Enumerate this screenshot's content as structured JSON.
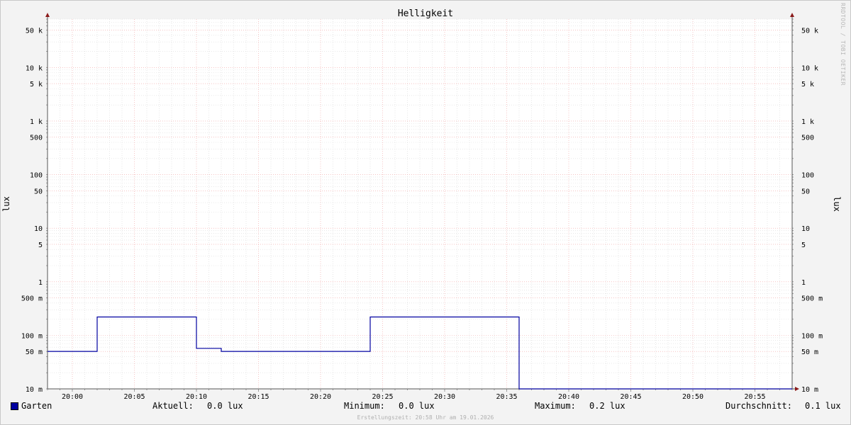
{
  "chart_data": {
    "type": "line",
    "title": "Helligkeit",
    "ylabel": "lux",
    "ylabel_right": "lux",
    "yscale": "log",
    "ylim": [
      0.01,
      80000
    ],
    "y_ticks": [
      {
        "v": 50000,
        "label": "50 k"
      },
      {
        "v": 10000,
        "label": "10 k"
      },
      {
        "v": 5000,
        "label": "5 k"
      },
      {
        "v": 1000,
        "label": "1 k"
      },
      {
        "v": 500,
        "label": "500"
      },
      {
        "v": 100,
        "label": "100"
      },
      {
        "v": 50,
        "label": "50"
      },
      {
        "v": 10,
        "label": "10"
      },
      {
        "v": 5,
        "label": "5"
      },
      {
        "v": 1,
        "label": "1"
      },
      {
        "v": 0.5,
        "label": "500 m"
      },
      {
        "v": 0.1,
        "label": "100 m"
      },
      {
        "v": 0.05,
        "label": "50 m"
      },
      {
        "v": 0.01,
        "label": "10 m"
      }
    ],
    "x_ticks": [
      "20:00",
      "20:05",
      "20:10",
      "20:15",
      "20:20",
      "20:25",
      "20:30",
      "20:35",
      "20:40",
      "20:45",
      "20:50",
      "20:55"
    ],
    "xlim": [
      "19:58",
      "20:58"
    ],
    "grid": true,
    "series": [
      {
        "name": "Garten",
        "color": "#0000a0",
        "step": true,
        "points": [
          [
            "19:58",
            0.05
          ],
          [
            "20:02",
            0.05
          ],
          [
            "20:02",
            0.22
          ],
          [
            "20:10",
            0.22
          ],
          [
            "20:10",
            0.057
          ],
          [
            "20:12",
            0.057
          ],
          [
            "20:12",
            0.05
          ],
          [
            "20:24",
            0.05
          ],
          [
            "20:24",
            0.22
          ],
          [
            "20:36",
            0.22
          ],
          [
            "20:36",
            0.01
          ],
          [
            "20:58",
            0.01
          ]
        ]
      }
    ]
  },
  "legend": {
    "series_name": "Garten",
    "swatch_color": "#0000a0",
    "aktuell_label": "Aktuell:",
    "aktuell_value": "0.0 lux",
    "minimum_label": "Minimum:",
    "minimum_value": "0.0 lux",
    "maximum_label": "Maximum:",
    "maximum_value": "0.2 lux",
    "avg_label": "Durchschnitt:",
    "avg_value": "0.1 lux"
  },
  "footer": {
    "created": "Erstellungszeit: 20:58 Uhr am 19.01.2026"
  },
  "watermark": "RRDTOOL / TOBI OETIKER"
}
